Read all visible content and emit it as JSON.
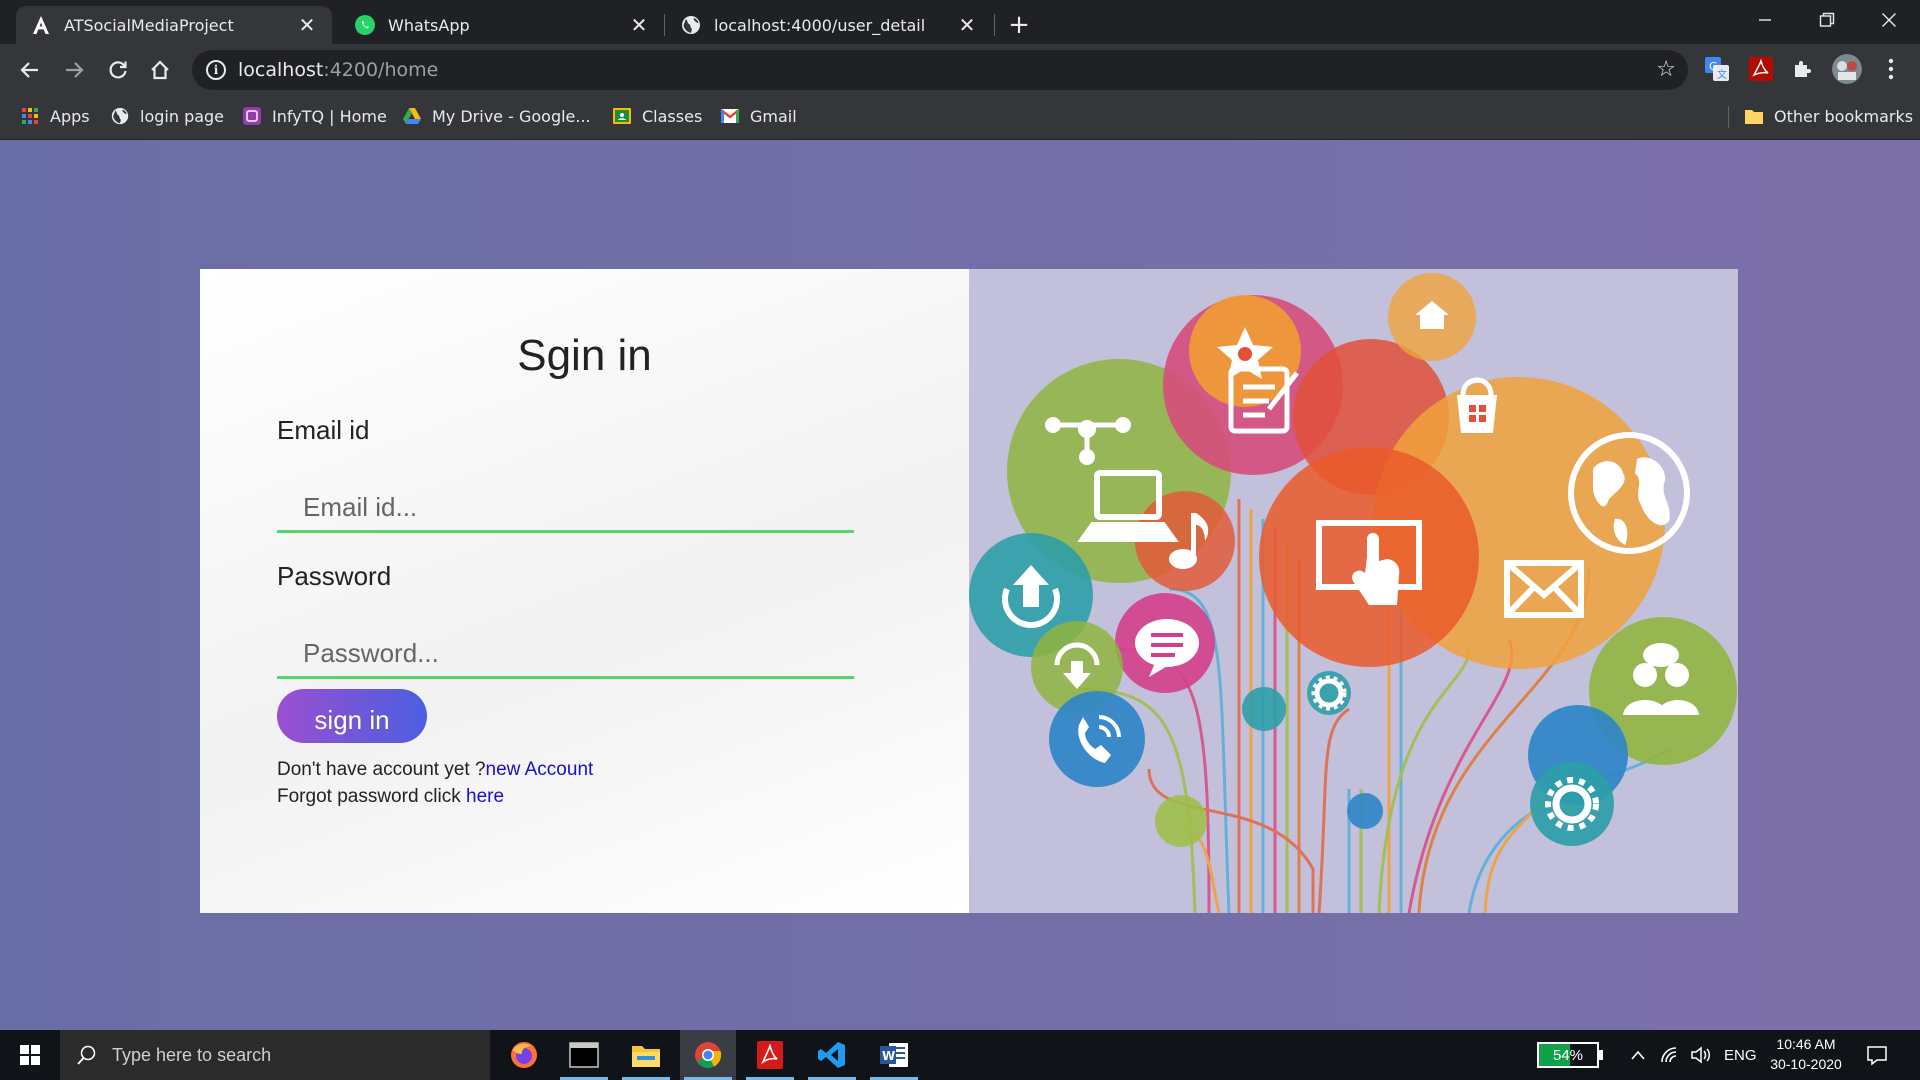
{
  "browser": {
    "tabs": [
      {
        "title": "ATSocialMediaProject",
        "favicon": "angular-icon",
        "active": true
      },
      {
        "title": "WhatsApp",
        "favicon": "whatsapp-icon",
        "active": false
      },
      {
        "title": "localhost:4000/user_detail",
        "favicon": "globe-icon",
        "active": false
      }
    ],
    "url_host": "localhost",
    "url_path": ":4200/home",
    "bookmarks": [
      {
        "label": "Apps",
        "icon": "apps-grid-icon"
      },
      {
        "label": "login page",
        "icon": "globe-icon"
      },
      {
        "label": "InfyTQ | Home",
        "icon": "infytq-icon"
      },
      {
        "label": "My Drive - Google...",
        "icon": "google-drive-icon"
      },
      {
        "label": "Classes",
        "icon": "classroom-icon"
      },
      {
        "label": "Gmail",
        "icon": "gmail-icon"
      }
    ],
    "other_bookmarks": "Other bookmarks"
  },
  "signin": {
    "title": "Sgin in",
    "email_label": "Email id",
    "email_placeholder": "Email id...",
    "password_label": "Password",
    "password_placeholder": "Password...",
    "button_label": "sign in",
    "no_account_text": "Don't have account yet ?",
    "new_account_link": "new Account",
    "forgot_text": "Forgot password click ",
    "forgot_link": "here"
  },
  "taskbar": {
    "search_placeholder": "Type here to search",
    "battery_percent": "54%",
    "battery_level": 0.54,
    "language": "ENG",
    "time": "10:46 AM",
    "date": "30-10-2020"
  },
  "colors": {
    "page_bg_start": "#6a6ea6",
    "page_bg_end": "#7c6fa8",
    "input_underline": "#53d769",
    "button_gradient_start": "#9b4fd0",
    "button_gradient_end": "#4a5fe0",
    "link": "#1a0dcc"
  }
}
